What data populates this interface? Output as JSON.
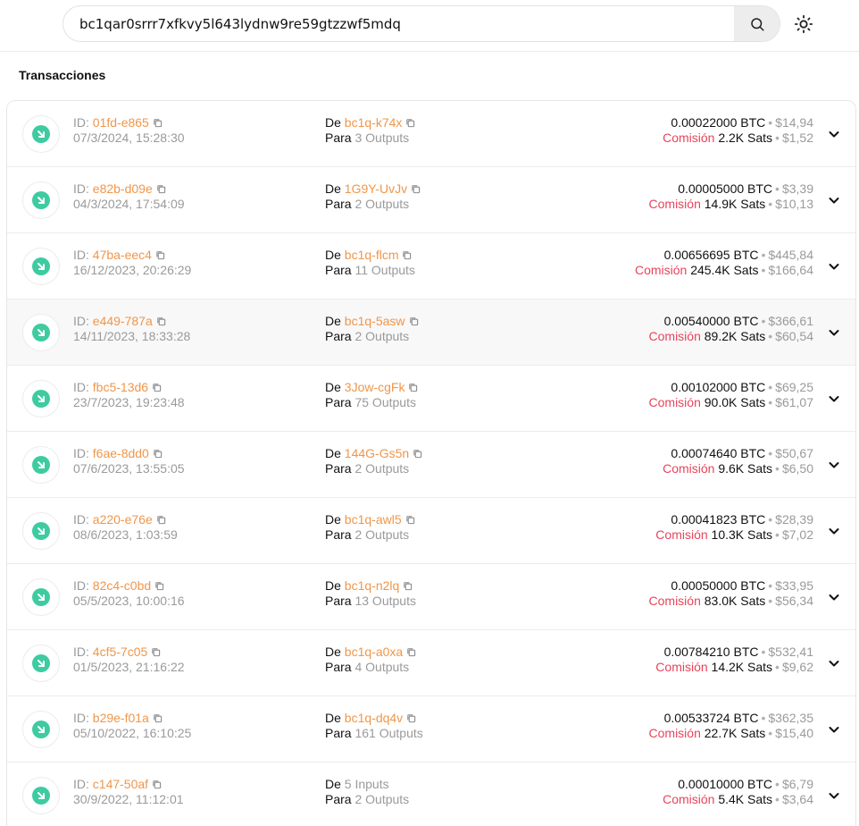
{
  "search": {
    "value": "bc1qar0srrr7xfkvy5l643lydnw9re59gtzzwf5mdq"
  },
  "section_title": "Transacciones",
  "labels": {
    "id": "ID:",
    "from": "De",
    "to": "Para",
    "fee": "Comisión"
  },
  "transactions": [
    {
      "id": "01fd-e865",
      "date": "07/3/2024, 15:28:30",
      "from": "bc1q-k74x",
      "from_kind": "address",
      "to": "3 Outputs",
      "btc": "0.00022000 BTC",
      "usd": "$14,94",
      "fee": "2.2K Sats",
      "fee_usd": "$1,52"
    },
    {
      "id": "e82b-d09e",
      "date": "04/3/2024, 17:54:09",
      "from": "1G9Y-UvJv",
      "from_kind": "address",
      "to": "2 Outputs",
      "btc": "0.00005000 BTC",
      "usd": "$3,39",
      "fee": "14.9K Sats",
      "fee_usd": "$10,13"
    },
    {
      "id": "47ba-eec4",
      "date": "16/12/2023, 20:26:29",
      "from": "bc1q-flcm",
      "from_kind": "address",
      "to": "11 Outputs",
      "btc": "0.00656695 BTC",
      "usd": "$445,84",
      "fee": "245.4K Sats",
      "fee_usd": "$166,64"
    },
    {
      "id": "e449-787a",
      "date": "14/11/2023, 18:33:28",
      "from": "bc1q-5asw",
      "from_kind": "address",
      "to": "2 Outputs",
      "btc": "0.00540000 BTC",
      "usd": "$366,61",
      "fee": "89.2K Sats",
      "fee_usd": "$60,54"
    },
    {
      "id": "fbc5-13d6",
      "date": "23/7/2023, 19:23:48",
      "from": "3Jow-cgFk",
      "from_kind": "address",
      "to": "75 Outputs",
      "btc": "0.00102000 BTC",
      "usd": "$69,25",
      "fee": "90.0K Sats",
      "fee_usd": "$61,07"
    },
    {
      "id": "f6ae-8dd0",
      "date": "07/6/2023, 13:55:05",
      "from": "144G-Gs5n",
      "from_kind": "address",
      "to": "2 Outputs",
      "btc": "0.00074640 BTC",
      "usd": "$50,67",
      "fee": "9.6K Sats",
      "fee_usd": "$6,50"
    },
    {
      "id": "a220-e76e",
      "date": "08/6/2023, 1:03:59",
      "from": "bc1q-awl5",
      "from_kind": "address",
      "to": "2 Outputs",
      "btc": "0.00041823 BTC",
      "usd": "$28,39",
      "fee": "10.3K Sats",
      "fee_usd": "$7,02"
    },
    {
      "id": "82c4-c0bd",
      "date": "05/5/2023, 10:00:16",
      "from": "bc1q-n2lq",
      "from_kind": "address",
      "to": "13 Outputs",
      "btc": "0.00050000 BTC",
      "usd": "$33,95",
      "fee": "83.0K Sats",
      "fee_usd": "$56,34"
    },
    {
      "id": "4cf5-7c05",
      "date": "01/5/2023, 21:16:22",
      "from": "bc1q-a0xa",
      "from_kind": "address",
      "to": "4 Outputs",
      "btc": "0.00784210 BTC",
      "usd": "$532,41",
      "fee": "14.2K Sats",
      "fee_usd": "$9,62"
    },
    {
      "id": "b29e-f01a",
      "date": "05/10/2022, 16:10:25",
      "from": "bc1q-dq4v",
      "from_kind": "address",
      "to": "161 Outputs",
      "btc": "0.00533724 BTC",
      "usd": "$362,35",
      "fee": "22.7K Sats",
      "fee_usd": "$15,40"
    },
    {
      "id": "c147-50af",
      "date": "30/9/2022, 11:12:01",
      "from": "5 Inputs",
      "from_kind": "inputs",
      "to": "2 Outputs",
      "btc": "0.00010000 BTC",
      "usd": "$6,79",
      "fee": "5.4K Sats",
      "fee_usd": "$3,64"
    }
  ],
  "icons": {
    "search": "search-icon",
    "theme": "sun-icon",
    "status": "arrow-down-right-icon",
    "copy": "copy-icon",
    "expand": "chevron-down-icon"
  },
  "colors": {
    "accent": "#f0964a",
    "received": "#3ecba0",
    "fee": "#e8445a"
  }
}
